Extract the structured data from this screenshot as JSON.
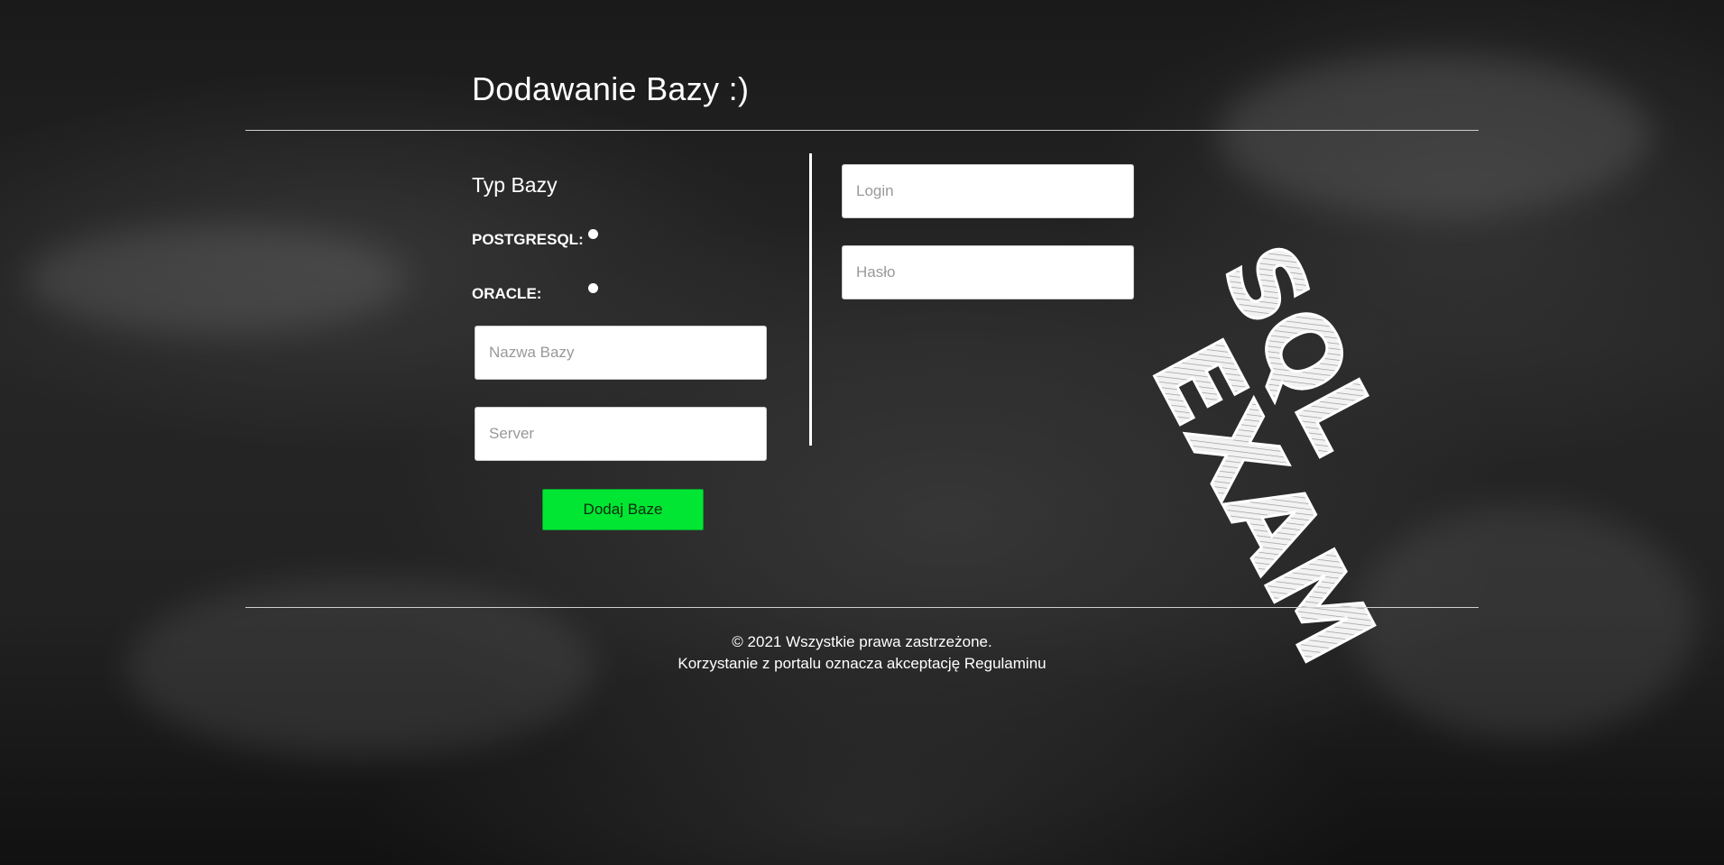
{
  "page": {
    "title": "Dodawanie Bazy :)"
  },
  "db_type": {
    "title": "Typ Bazy",
    "options": [
      {
        "label": "POSTGRESQL:"
      },
      {
        "label": "ORACLE:"
      }
    ]
  },
  "form": {
    "db_name_placeholder": "Nazwa Bazy",
    "server_placeholder": "Server",
    "login_placeholder": "Login",
    "password_placeholder": "Hasło",
    "submit_label": "Dodaj Baze"
  },
  "logo": {
    "line1": "SQL",
    "line2": "EXAM"
  },
  "footer": {
    "copyright": "© 2021 Wszystkie prawa zastrzeżone.",
    "terms": "Korzystanie z portalu oznacza akceptację Regulaminu"
  }
}
